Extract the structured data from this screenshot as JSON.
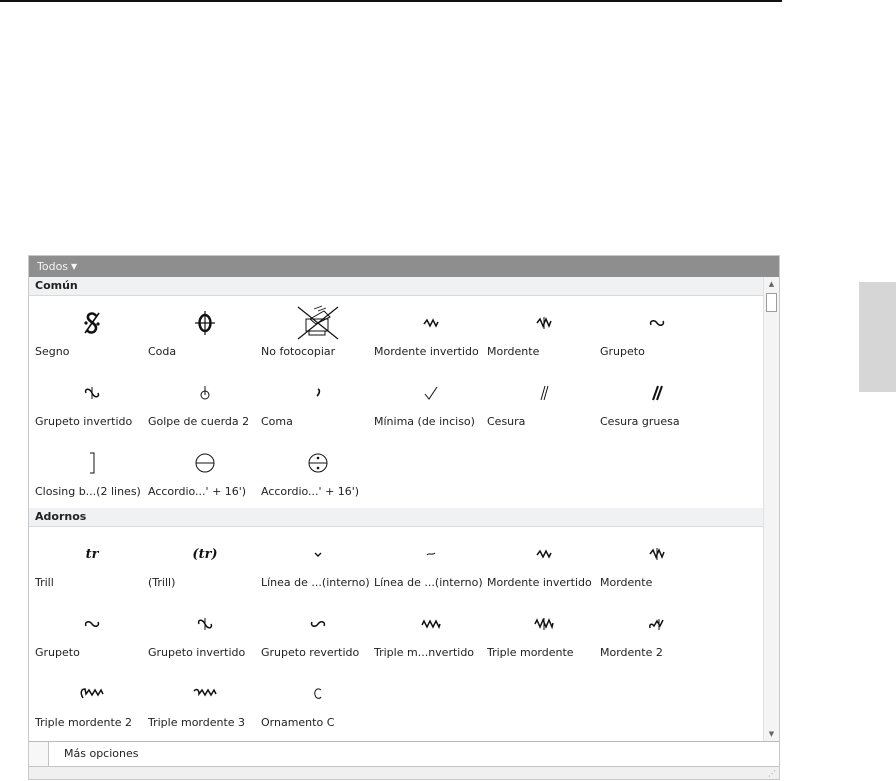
{
  "palette": {
    "filter_label": "Todos",
    "sections": [
      {
        "title": "Común",
        "items": [
          {
            "label": "Segno",
            "icon": "segno-icon"
          },
          {
            "label": "Coda",
            "icon": "coda-icon"
          },
          {
            "label": "No fotocopiar",
            "icon": "no-photocopy-icon"
          },
          {
            "label": "Mordente invertido",
            "icon": "inverted-mordent-icon"
          },
          {
            "label": "Mordente",
            "icon": "mordent-icon"
          },
          {
            "label": "Grupeto",
            "icon": "turn-icon"
          },
          {
            "label": "Grupeto invertido",
            "icon": "inverted-turn-icon"
          },
          {
            "label": "Golpe de cuerda 2",
            "icon": "snap-pizzicato-icon"
          },
          {
            "label": "Coma",
            "icon": "comma-icon"
          },
          {
            "label": "Mínima (de inciso)",
            "icon": "tick-icon"
          },
          {
            "label": "Cesura",
            "icon": "caesura-icon"
          },
          {
            "label": "Cesura gruesa",
            "icon": "thick-caesura-icon"
          },
          {
            "label": "Closing b...(2 lines)",
            "icon": "closing-bracket-icon"
          },
          {
            "label": "Accordio...' + 16')",
            "icon": "accordion-register-icon"
          },
          {
            "label": "Accordio...' + 16')",
            "icon": "accordion-register-dot-icon"
          }
        ]
      },
      {
        "title": "Adornos",
        "items": [
          {
            "label": "Trill",
            "icon": "trill-icon"
          },
          {
            "label": "(Trill)",
            "icon": "trill-parenthesized-icon"
          },
          {
            "label": "Línea de ...(interno)",
            "icon": "short-line-icon"
          },
          {
            "label": "Línea de ...(interno)",
            "icon": "tilde-line-icon"
          },
          {
            "label": "Mordente invertido",
            "icon": "inverted-mordent-icon"
          },
          {
            "label": "Mordente",
            "icon": "mordent-icon"
          },
          {
            "label": "Grupeto",
            "icon": "turn-icon"
          },
          {
            "label": "Grupeto invertido",
            "icon": "inverted-turn-icon"
          },
          {
            "label": "Grupeto revertido",
            "icon": "reversed-turn-icon"
          },
          {
            "label": "Triple m...nvertido",
            "icon": "triple-inverted-mordent-icon"
          },
          {
            "label": "Triple mordente",
            "icon": "triple-mordent-icon"
          },
          {
            "label": "Mordente 2",
            "icon": "mordent-2-icon"
          },
          {
            "label": "Triple mordente 2",
            "icon": "triple-mordent-2-icon"
          },
          {
            "label": "Triple mordente 3",
            "icon": "triple-mordent-3-icon"
          },
          {
            "label": "Ornamento C",
            "icon": "ornament-c-icon"
          }
        ]
      }
    ],
    "more_options": "Más opciones"
  }
}
